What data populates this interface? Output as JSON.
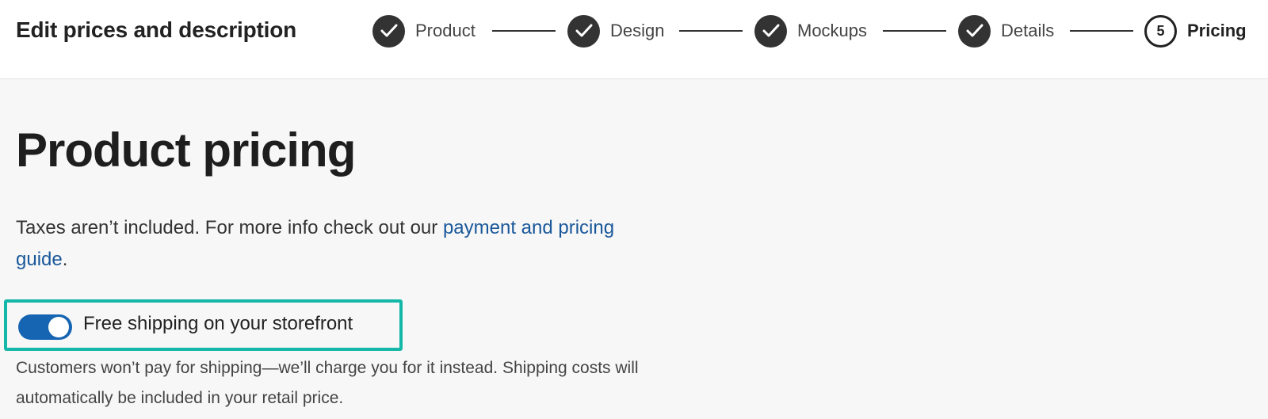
{
  "header": {
    "title": "Edit prices and description",
    "steps": [
      {
        "label": "Product",
        "state": "done",
        "icon": "check-icon"
      },
      {
        "label": "Design",
        "state": "done",
        "icon": "check-icon"
      },
      {
        "label": "Mockups",
        "state": "done",
        "icon": "check-icon"
      },
      {
        "label": "Details",
        "state": "done",
        "icon": "check-icon"
      },
      {
        "label": "Pricing",
        "state": "current",
        "number": "5"
      }
    ]
  },
  "main": {
    "title": "Product pricing",
    "info_text_before": "Taxes aren’t included. For more info check out our ",
    "info_link": "payment and pricing guide",
    "info_text_after": ".",
    "free_shipping": {
      "label": "Free shipping on your storefront",
      "enabled": true,
      "description": "Customers won’t pay for shipping—we’ll charge you for it instead. Shipping costs will automatically be included in your retail price."
    }
  },
  "colors": {
    "accent": "#1565b2",
    "link": "#19579a",
    "highlight_border": "#14b8a8",
    "step_done": "#333333"
  }
}
